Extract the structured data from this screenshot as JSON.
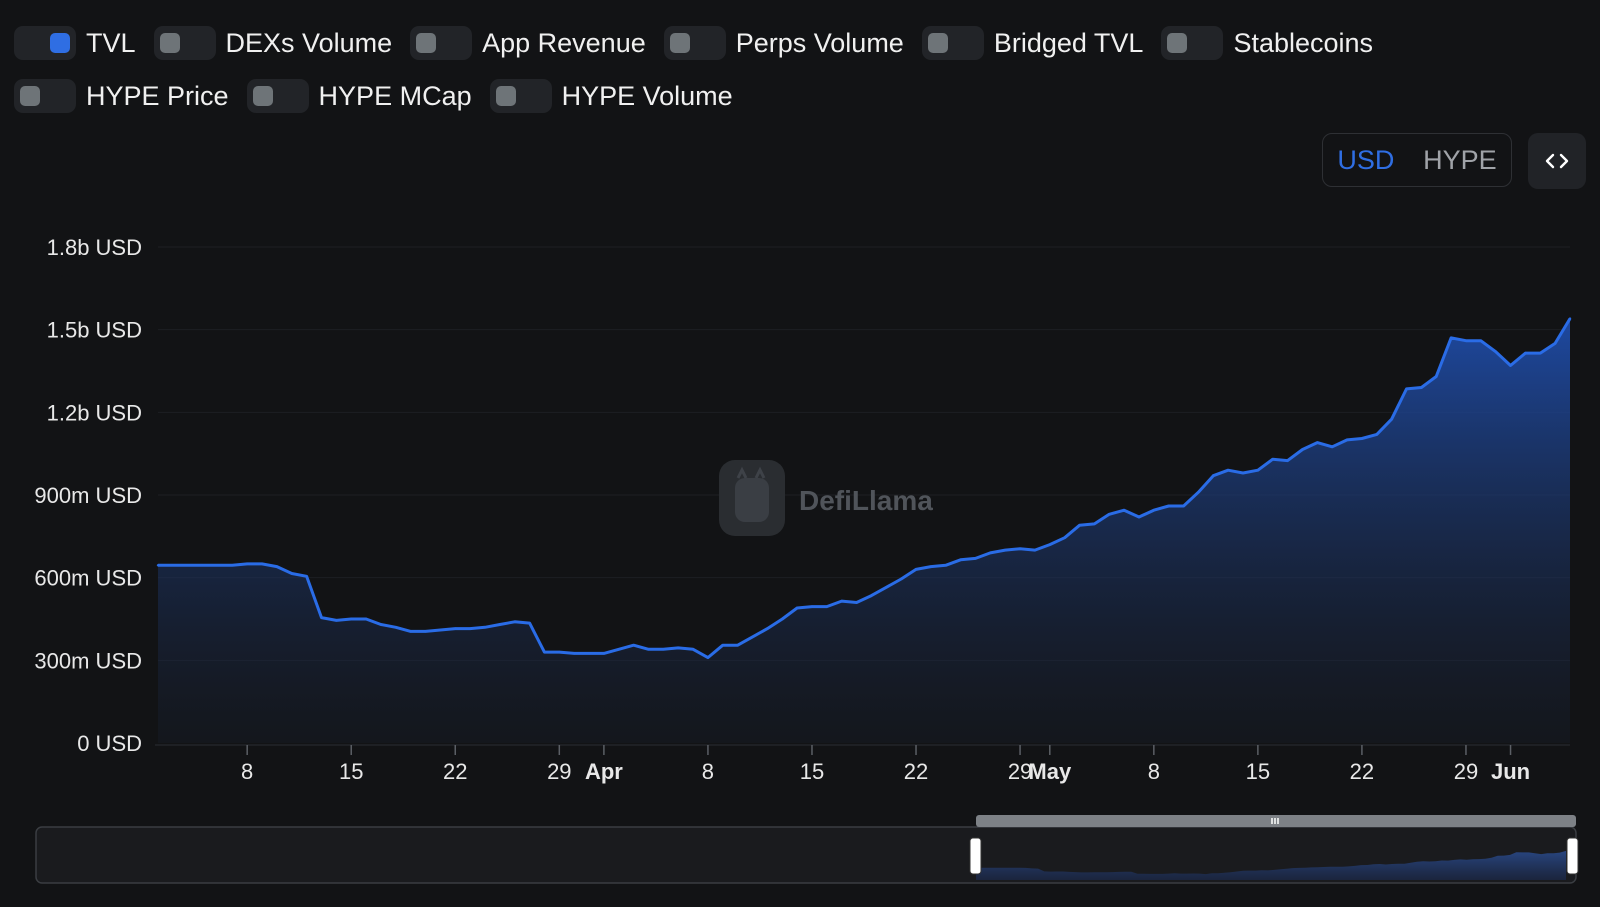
{
  "toggles": {
    "row1": [
      {
        "label": "TVL",
        "on": true
      },
      {
        "label": "DEXs Volume",
        "on": false
      },
      {
        "label": "App Revenue",
        "on": false
      },
      {
        "label": "Perps Volume",
        "on": false
      },
      {
        "label": "Bridged TVL",
        "on": false
      },
      {
        "label": "Stablecoins",
        "on": false
      }
    ],
    "row2": [
      {
        "label": "HYPE Price",
        "on": false
      },
      {
        "label": "HYPE MCap",
        "on": false
      },
      {
        "label": "HYPE Volume",
        "on": false
      }
    ]
  },
  "unit_toggle": {
    "usd": "USD",
    "hype": "HYPE",
    "active": "USD"
  },
  "embed_icon": "code-brackets-icon",
  "watermark": "DefiLlama",
  "colors": {
    "accent": "#2f6ee3",
    "background": "#121315",
    "line": "#2a6ce6"
  },
  "chart_data": {
    "type": "area",
    "series": [
      {
        "name": "TVL",
        "color": "#2a6ce6"
      }
    ],
    "x_start": "2025-03-02",
    "x_end": "2025-06-03",
    "ylim": [
      0,
      1800000000
    ],
    "yticks": [
      {
        "value": 0,
        "label": "0 USD"
      },
      {
        "value": 300000000,
        "label": "300m USD"
      },
      {
        "value": 600000000,
        "label": "600m USD"
      },
      {
        "value": 900000000,
        "label": "900m USD"
      },
      {
        "value": 1200000000,
        "label": "1.2b USD"
      },
      {
        "value": 1500000000,
        "label": "1.5b USD"
      },
      {
        "value": 1800000000,
        "label": "1.8b USD"
      }
    ],
    "xticks": [
      {
        "date": "2025-03-08",
        "label": "8",
        "bold": false
      },
      {
        "date": "2025-03-15",
        "label": "15",
        "bold": false
      },
      {
        "date": "2025-03-22",
        "label": "22",
        "bold": false
      },
      {
        "date": "2025-03-29",
        "label": "29",
        "bold": false
      },
      {
        "date": "2025-04-01",
        "label": "Apr",
        "bold": true
      },
      {
        "date": "2025-04-08",
        "label": "8",
        "bold": false
      },
      {
        "date": "2025-04-15",
        "label": "15",
        "bold": false
      },
      {
        "date": "2025-04-22",
        "label": "22",
        "bold": false
      },
      {
        "date": "2025-04-29",
        "label": "29",
        "bold": false
      },
      {
        "date": "2025-05-01",
        "label": "May",
        "bold": true
      },
      {
        "date": "2025-05-08",
        "label": "8",
        "bold": false
      },
      {
        "date": "2025-05-15",
        "label": "15",
        "bold": false
      },
      {
        "date": "2025-05-22",
        "label": "22",
        "bold": false
      },
      {
        "date": "2025-05-29",
        "label": "29",
        "bold": false
      },
      {
        "date": "2025-06-01",
        "label": "Jun",
        "bold": true
      }
    ],
    "points": [
      [
        "2025-03-02",
        645000000
      ],
      [
        "2025-03-03",
        645000000
      ],
      [
        "2025-03-04",
        645000000
      ],
      [
        "2025-03-05",
        645000000
      ],
      [
        "2025-03-06",
        645000000
      ],
      [
        "2025-03-07",
        645000000
      ],
      [
        "2025-03-08",
        650000000
      ],
      [
        "2025-03-09",
        650000000
      ],
      [
        "2025-03-10",
        640000000
      ],
      [
        "2025-03-11",
        615000000
      ],
      [
        "2025-03-12",
        605000000
      ],
      [
        "2025-03-13",
        455000000
      ],
      [
        "2025-03-14",
        445000000
      ],
      [
        "2025-03-15",
        450000000
      ],
      [
        "2025-03-16",
        450000000
      ],
      [
        "2025-03-17",
        430000000
      ],
      [
        "2025-03-18",
        420000000
      ],
      [
        "2025-03-19",
        405000000
      ],
      [
        "2025-03-20",
        405000000
      ],
      [
        "2025-03-21",
        410000000
      ],
      [
        "2025-03-22",
        415000000
      ],
      [
        "2025-03-23",
        415000000
      ],
      [
        "2025-03-24",
        420000000
      ],
      [
        "2025-03-25",
        430000000
      ],
      [
        "2025-03-26",
        440000000
      ],
      [
        "2025-03-27",
        435000000
      ],
      [
        "2025-03-28",
        330000000
      ],
      [
        "2025-03-29",
        330000000
      ],
      [
        "2025-03-30",
        325000000
      ],
      [
        "2025-03-31",
        325000000
      ],
      [
        "2025-04-01",
        325000000
      ],
      [
        "2025-04-02",
        340000000
      ],
      [
        "2025-04-03",
        355000000
      ],
      [
        "2025-04-04",
        340000000
      ],
      [
        "2025-04-05",
        340000000
      ],
      [
        "2025-04-06",
        345000000
      ],
      [
        "2025-04-07",
        340000000
      ],
      [
        "2025-04-08",
        310000000
      ],
      [
        "2025-04-09",
        355000000
      ],
      [
        "2025-04-10",
        355000000
      ],
      [
        "2025-04-11",
        385000000
      ],
      [
        "2025-04-12",
        415000000
      ],
      [
        "2025-04-13",
        450000000
      ],
      [
        "2025-04-14",
        490000000
      ],
      [
        "2025-04-15",
        495000000
      ],
      [
        "2025-04-16",
        495000000
      ],
      [
        "2025-04-17",
        515000000
      ],
      [
        "2025-04-18",
        510000000
      ],
      [
        "2025-04-19",
        535000000
      ],
      [
        "2025-04-20",
        565000000
      ],
      [
        "2025-04-21",
        595000000
      ],
      [
        "2025-04-22",
        630000000
      ],
      [
        "2025-04-23",
        640000000
      ],
      [
        "2025-04-24",
        645000000
      ],
      [
        "2025-04-25",
        665000000
      ],
      [
        "2025-04-26",
        670000000
      ],
      [
        "2025-04-27",
        690000000
      ],
      [
        "2025-04-28",
        700000000
      ],
      [
        "2025-04-29",
        705000000
      ],
      [
        "2025-04-30",
        700000000
      ],
      [
        "2025-05-01",
        720000000
      ],
      [
        "2025-05-02",
        745000000
      ],
      [
        "2025-05-03",
        790000000
      ],
      [
        "2025-05-04",
        795000000
      ],
      [
        "2025-05-05",
        830000000
      ],
      [
        "2025-05-06",
        845000000
      ],
      [
        "2025-05-07",
        820000000
      ],
      [
        "2025-05-08",
        845000000
      ],
      [
        "2025-05-09",
        860000000
      ],
      [
        "2025-05-10",
        860000000
      ],
      [
        "2025-05-11",
        910000000
      ],
      [
        "2025-05-12",
        970000000
      ],
      [
        "2025-05-13",
        990000000
      ],
      [
        "2025-05-14",
        980000000
      ],
      [
        "2025-05-15",
        990000000
      ],
      [
        "2025-05-16",
        1030000000
      ],
      [
        "2025-05-17",
        1025000000
      ],
      [
        "2025-05-18",
        1065000000
      ],
      [
        "2025-05-19",
        1090000000
      ],
      [
        "2025-05-20",
        1075000000
      ],
      [
        "2025-05-21",
        1100000000
      ],
      [
        "2025-05-22",
        1105000000
      ],
      [
        "2025-05-23",
        1120000000
      ],
      [
        "2025-05-24",
        1175000000
      ],
      [
        "2025-05-25",
        1285000000
      ],
      [
        "2025-05-26",
        1290000000
      ],
      [
        "2025-05-27",
        1330000000
      ],
      [
        "2025-05-28",
        1470000000
      ],
      [
        "2025-05-29",
        1460000000
      ],
      [
        "2025-05-30",
        1460000000
      ],
      [
        "2025-05-31",
        1420000000
      ],
      [
        "2025-06-01",
        1370000000
      ],
      [
        "2025-06-02",
        1415000000
      ],
      [
        "2025-06-03",
        1415000000
      ],
      [
        "2025-06-04",
        1450000000
      ],
      [
        "2025-06-05",
        1540000000
      ]
    ],
    "navigator": {
      "selected_start": "2025-03-02",
      "selected_end": "2025-06-05"
    }
  }
}
